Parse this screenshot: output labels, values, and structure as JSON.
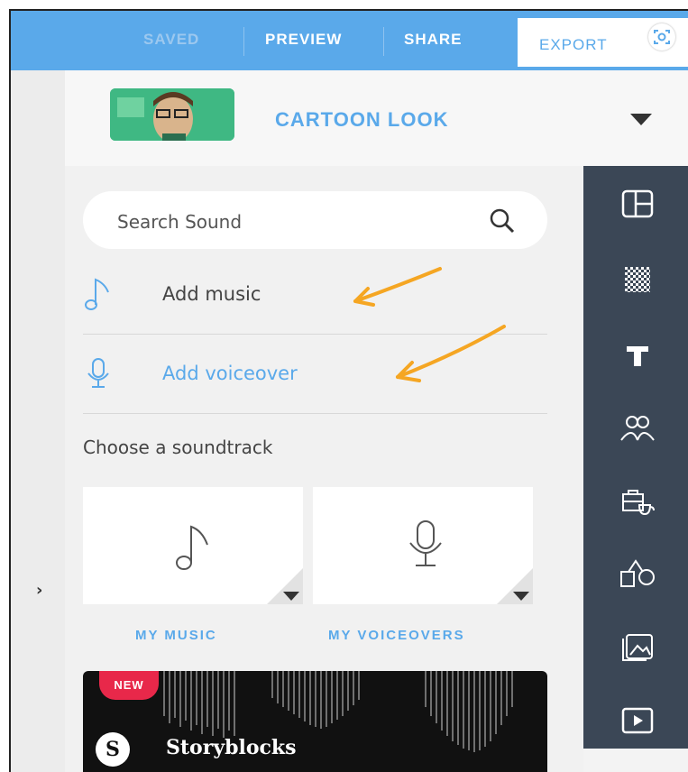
{
  "topbar": {
    "saved_label": "SAVED",
    "preview_label": "PREVIEW",
    "share_label": "SHARE",
    "export_label": "EXPORT"
  },
  "project": {
    "title": "CARTOON LOOK"
  },
  "sound_panel": {
    "search_placeholder": "Search Sound",
    "add_music_label": "Add music",
    "add_voiceover_label": "Add voiceover",
    "choose_heading": "Choose a soundtrack",
    "my_music_label": "MY MUSIC",
    "my_voiceovers_label": "MY VOICEOVERS",
    "banner_badge": "NEW",
    "banner_brand": "Storyblocks"
  },
  "right_toolbar": {
    "icons": [
      "layout-icon",
      "background-icon",
      "text-icon",
      "characters-icon",
      "props-icon",
      "shapes-icon",
      "images-icon",
      "video-icon"
    ]
  },
  "colors": {
    "accent": "#5aa9ea",
    "toolbar_dark": "#3b4756",
    "new_badge": "#e8284a",
    "annotation_arrow": "#f5a623"
  }
}
